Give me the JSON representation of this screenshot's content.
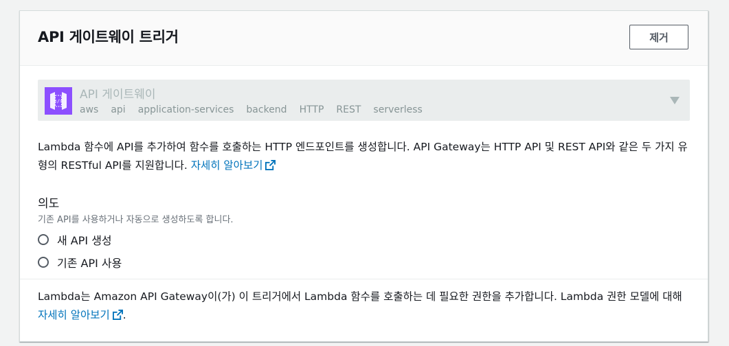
{
  "header": {
    "title": "API 게이트웨이 트리거",
    "remove_label": "제거"
  },
  "service_select": {
    "name": "API 게이트웨이",
    "icon": "api-gateway-icon",
    "tags": [
      "aws",
      "api",
      "application-services",
      "backend",
      "HTTP",
      "REST",
      "serverless"
    ]
  },
  "description": {
    "text": "Lambda 함수에 API를 추가하여 함수를 호출하는 HTTP 엔드포인트를 생성합니다. API Gateway는 HTTP API 및 REST API와 같은 두 가지 유형의 RESTful API를 지원합니다.",
    "link": "자세히 알아보기"
  },
  "intent": {
    "label": "의도",
    "hint": "기존 API를 사용하거나 자동으로 생성하도록 합니다.",
    "options": [
      {
        "label": "새 API 생성",
        "selected": false
      },
      {
        "label": "기존 API 사용",
        "selected": false
      }
    ]
  },
  "permission": {
    "text": "Lambda는 Amazon API Gateway이(가) 이 트리거에서 Lambda 함수를 호출하는 데 필요한 권한을 추가합니다. Lambda 권한 모델에 대해",
    "link": "자세히 알아보기",
    "suffix": "."
  },
  "colors": {
    "link": "#0073bb",
    "service_icon_bg": "#8c4fff"
  }
}
